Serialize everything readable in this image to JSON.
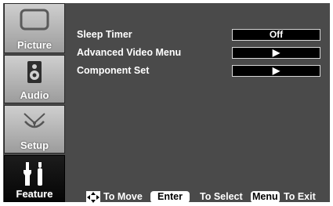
{
  "sidebar": {
    "tabs": [
      {
        "label": "Picture",
        "icon": "monitor-icon"
      },
      {
        "label": "Audio",
        "icon": "speaker-icon"
      },
      {
        "label": "Setup",
        "icon": "satellite-dish-icon"
      },
      {
        "label": "Feature",
        "icon": "tools-icon",
        "active": true
      }
    ]
  },
  "menu": {
    "items": [
      {
        "label": "Sleep Timer",
        "value": "Off"
      },
      {
        "label": "Advanced Video Menu",
        "value": "▶"
      },
      {
        "label": "Component Set",
        "value": "▶"
      }
    ]
  },
  "footer": {
    "move_text": "To Move",
    "enter_key": "Enter",
    "select_text": "To Select",
    "menu_key": "Menu",
    "exit_text": "To Exit"
  },
  "colors": {
    "background": "#4a4a4a",
    "tab_inactive": "#b8b8b8",
    "tab_active": "#0a0a0a",
    "value_box": "#000000",
    "text": "#ffffff"
  }
}
